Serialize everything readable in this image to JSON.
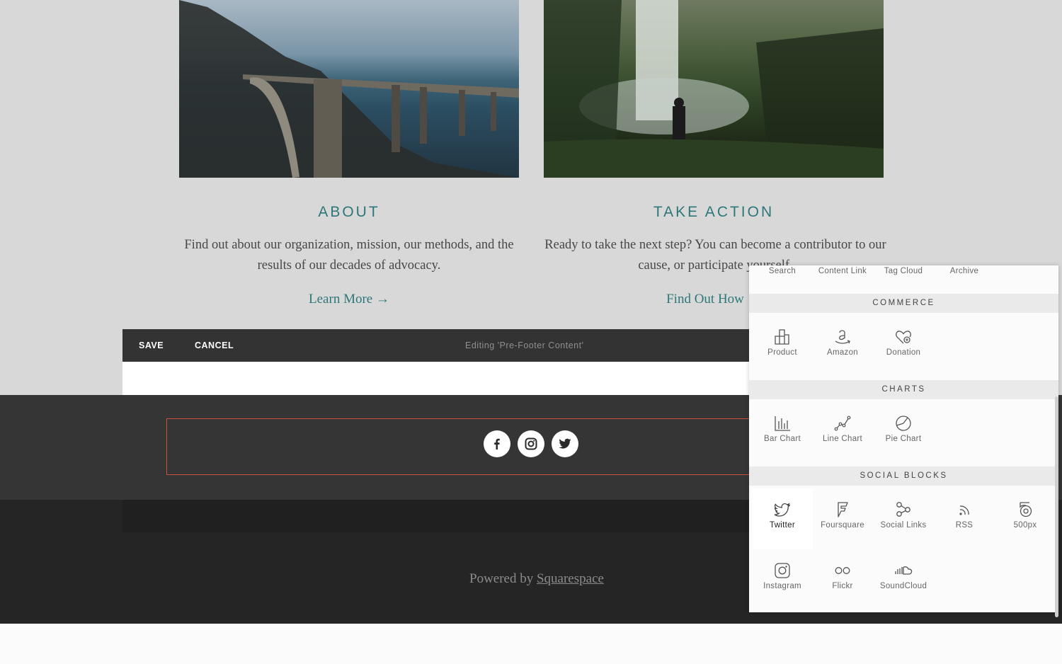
{
  "features": {
    "about": {
      "title": "ABOUT",
      "body": "Find out about our organization, mission, our methods, and the results of our decades of advocacy.",
      "link": "Learn More →"
    },
    "take_action": {
      "title": "TAKE ACTION",
      "body": "Ready to take the next step? You can become a contributor to our cause, or participate yourself.",
      "link": "Find Out How"
    }
  },
  "edit_bar": {
    "save": "SAVE",
    "cancel": "CANCEL",
    "status": "Editing 'Pre-Footer Content'"
  },
  "social_icons": [
    "facebook-icon",
    "instagram-icon",
    "twitter-icon"
  ],
  "footer": {
    "powered_prefix": "Powered by",
    "powered_link": "Squarespace"
  },
  "block_panel": {
    "top_row": [
      "Search",
      "Content Link",
      "Tag Cloud",
      "Archive"
    ],
    "commerce": {
      "header": "COMMERCE",
      "items": [
        "Product",
        "Amazon",
        "Donation"
      ]
    },
    "charts": {
      "header": "CHARTS",
      "items": [
        "Bar Chart",
        "Line Chart",
        "Pie Chart"
      ]
    },
    "social_blocks": {
      "header": "SOCIAL BLOCKS",
      "items": [
        "Twitter",
        "Foursquare",
        "Social Links",
        "RSS",
        "500px",
        "Instagram",
        "Flickr",
        "SoundCloud"
      ]
    },
    "selected": "Twitter"
  },
  "colors": {
    "accent": "#2e7779",
    "selection": "#c8503c",
    "bar": "#333333"
  }
}
